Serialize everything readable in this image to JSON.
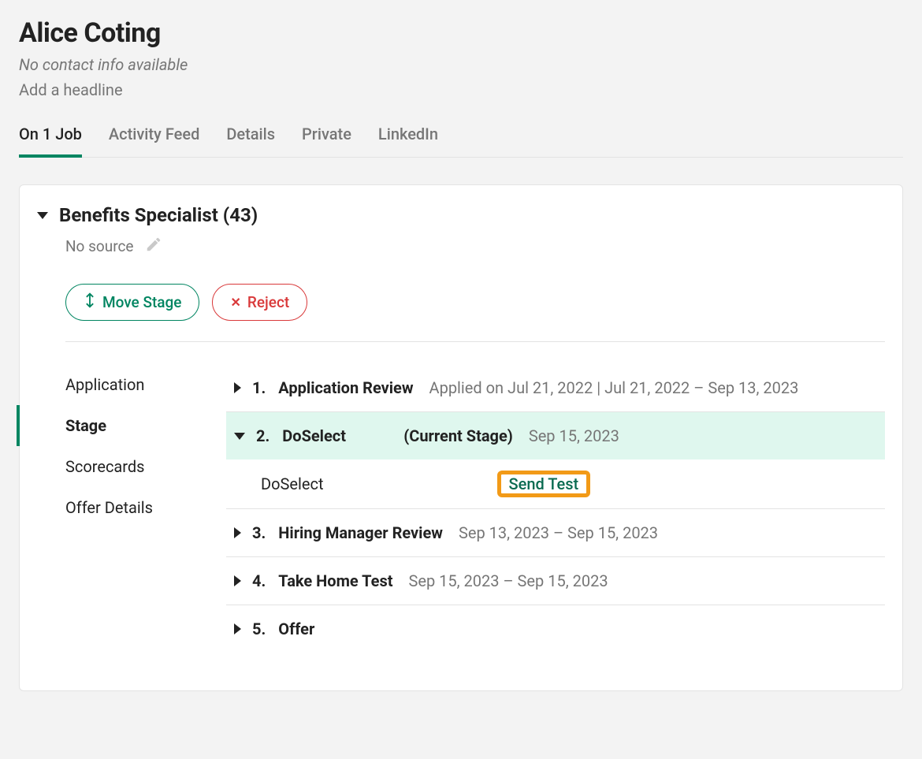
{
  "candidate": {
    "name": "Alice Coting",
    "contact_info": "No contact info available",
    "headline_link": "Add a headline"
  },
  "tabs": {
    "on_job": "On 1 Job",
    "activity_feed": "Activity Feed",
    "details": "Details",
    "private": "Private",
    "linkedin": "LinkedIn"
  },
  "job": {
    "title": "Benefits Specialist (43)",
    "source": "No source"
  },
  "actions": {
    "move_stage": "Move Stage",
    "reject": "Reject"
  },
  "side_nav": {
    "application": "Application",
    "stage": "Stage",
    "scorecards": "Scorecards",
    "offer_details": "Offer Details"
  },
  "stages": {
    "s1": {
      "num": "1.",
      "name": "Application Review",
      "meta": "Applied on Jul 21, 2022 | Jul 21, 2022 – Sep 13, 2023"
    },
    "s2": {
      "num": "2.",
      "name": "DoSelect",
      "label": "(Current Stage)",
      "meta": "Sep 15, 2023",
      "sub_name": "DoSelect",
      "send_test": "Send Test"
    },
    "s3": {
      "num": "3.",
      "name": "Hiring Manager Review",
      "meta": "Sep 13, 2023 – Sep 15, 2023"
    },
    "s4": {
      "num": "4.",
      "name": "Take Home Test",
      "meta": "Sep 15, 2023 – Sep 15, 2023"
    },
    "s5": {
      "num": "5.",
      "name": "Offer"
    }
  }
}
